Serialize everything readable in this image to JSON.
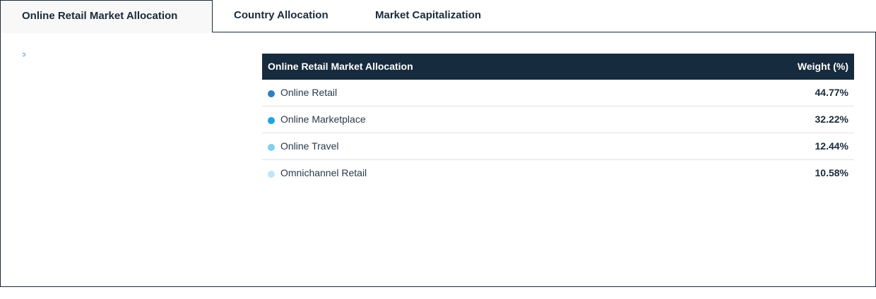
{
  "tabs": [
    {
      "label": "Online Retail Market Allocation",
      "active": true
    },
    {
      "label": "Country Allocation",
      "active": false
    },
    {
      "label": "Market Capitalization",
      "active": false
    }
  ],
  "table": {
    "header_left": "Online Retail Market Allocation",
    "header_right": "Weight (%)",
    "rows": [
      {
        "label": "Online Retail",
        "value": "44.77%",
        "color": "#2f7fc1"
      },
      {
        "label": "Online Marketplace",
        "value": "32.22%",
        "color": "#1ba6e0"
      },
      {
        "label": "Online Travel",
        "value": "12.44%",
        "color": "#7fcff0"
      },
      {
        "label": "Omnichannel Retail",
        "value": "10.58%",
        "color": "#bfe6f6"
      }
    ]
  },
  "colors": {
    "header_bg": "#172b3e",
    "border": "#1b2a3a",
    "loader": "#2e9bd6"
  },
  "icons": {
    "loader": "loading-spinner-icon"
  }
}
